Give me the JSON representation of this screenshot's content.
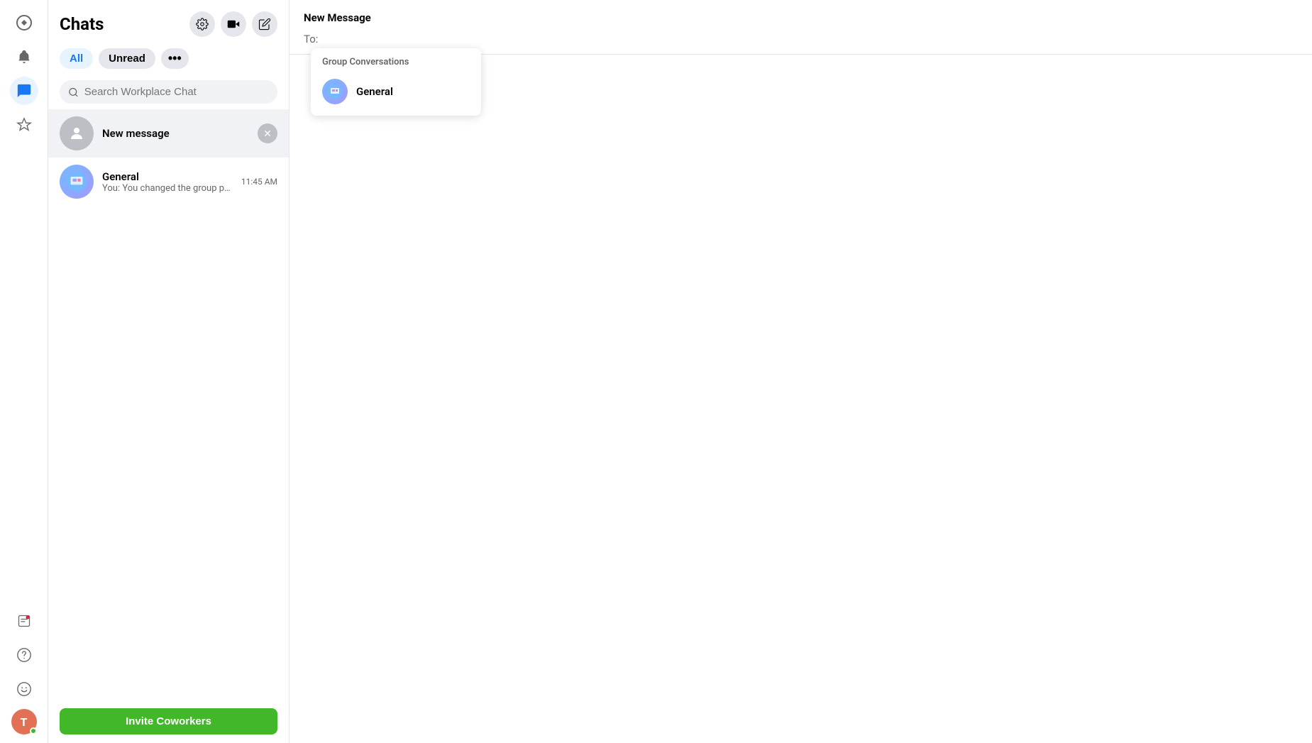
{
  "nav": {
    "icons": [
      {
        "name": "workplace-logo",
        "symbol": "⬡",
        "active": false
      },
      {
        "name": "bell-icon",
        "symbol": "🔔",
        "active": false
      },
      {
        "name": "chat-icon",
        "symbol": "💬",
        "active": true
      },
      {
        "name": "tools-icon",
        "symbol": "✂",
        "active": false
      }
    ],
    "bottom_icons": [
      {
        "name": "feedback-icon",
        "symbol": "📋"
      },
      {
        "name": "help-icon",
        "symbol": "?"
      },
      {
        "name": "emoji-icon",
        "symbol": "☺"
      }
    ],
    "avatar": {
      "letter": "T",
      "color": "#e17055"
    }
  },
  "sidebar": {
    "title": "Chats",
    "actions": [
      {
        "name": "settings-button",
        "symbol": "⚙"
      },
      {
        "name": "video-button",
        "symbol": "🎬"
      },
      {
        "name": "compose-button",
        "symbol": "✏"
      }
    ],
    "tabs": [
      {
        "label": "All",
        "active": true
      },
      {
        "label": "Unread",
        "active": false
      },
      {
        "label": "...",
        "active": false
      }
    ],
    "search_placeholder": "Search Workplace Chat",
    "new_message_label": "New message",
    "invite_button": "Invite Coworkers",
    "conversations": [
      {
        "name": "General",
        "preview": "You: You changed the group photo.",
        "time": "11:45 AM",
        "type": "group"
      }
    ]
  },
  "main": {
    "title": "New Message",
    "to_label": "To:",
    "dropdown": {
      "section_label": "Group Conversations",
      "items": [
        {
          "name": "General",
          "type": "group"
        }
      ]
    }
  }
}
